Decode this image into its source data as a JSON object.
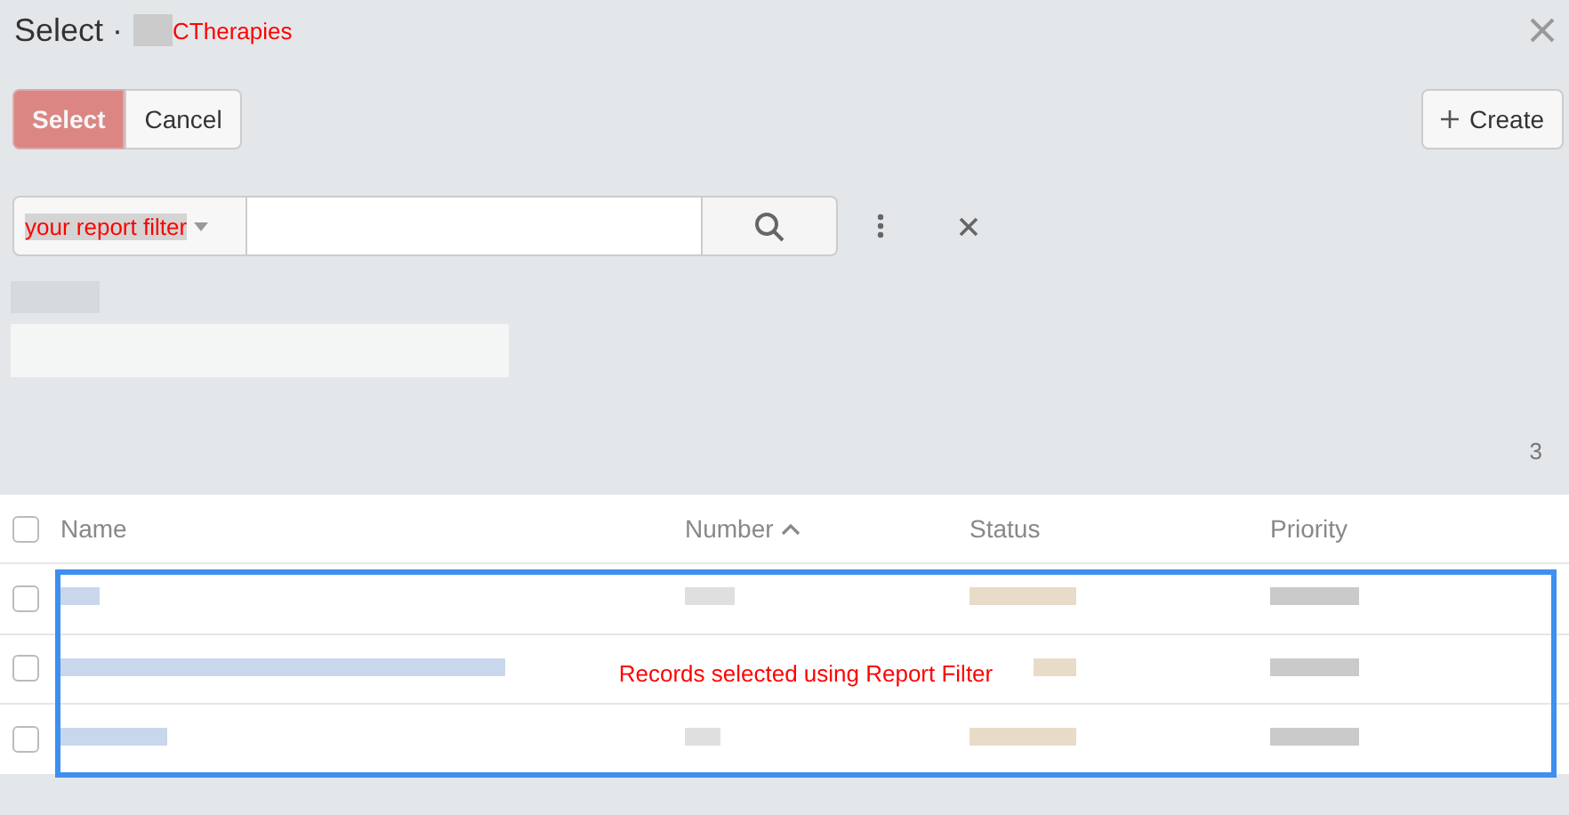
{
  "dialog": {
    "title": "Select ·",
    "title_note": "CTherapies"
  },
  "buttons": [
    {
      "label": "Select",
      "kind": "primary",
      "disabled": true
    },
    {
      "label": "Cancel",
      "kind": "secondary",
      "disabled": false
    }
  ],
  "create_button": {
    "label": "Create"
  },
  "filter": {
    "select_label": "your report filter"
  },
  "record_count": "3",
  "table": {
    "all_checked": false,
    "columns": [
      {
        "label": "Name",
        "sorted": false
      },
      {
        "label": "Number",
        "sorted": true
      },
      {
        "label": "Status",
        "sorted": false
      },
      {
        "label": "Priority",
        "sorted": false
      }
    ],
    "rows": [
      {
        "checked": false
      },
      {
        "checked": false
      },
      {
        "checked": false
      }
    ]
  },
  "annotation": {
    "text": "Records selected using Report Filter"
  }
}
